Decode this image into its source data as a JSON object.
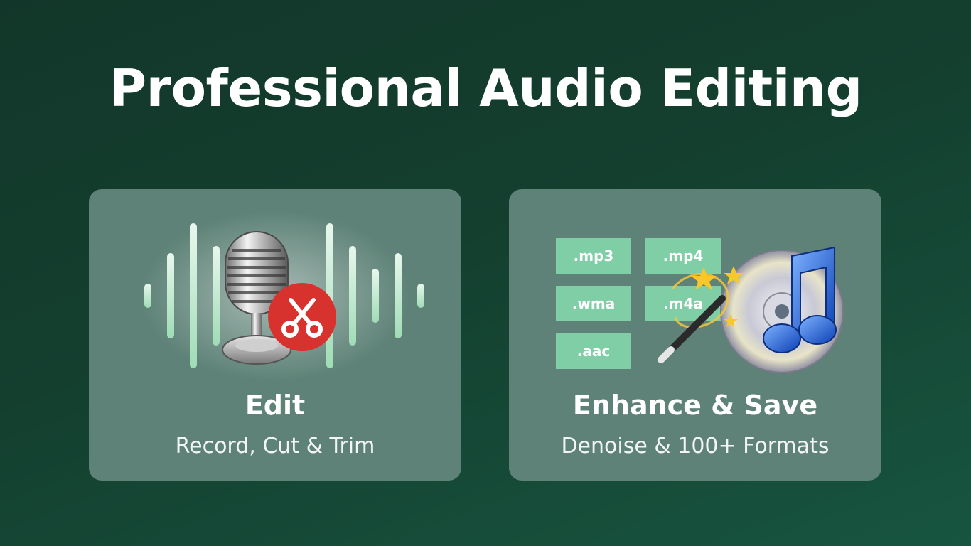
{
  "headline": "Professional Audio Editing",
  "cards": [
    {
      "title": "Edit",
      "subtitle": "Record, Cut & Trim",
      "icons": [
        "soundwave-icon",
        "microphone-icon",
        "scissors-icon"
      ]
    },
    {
      "title": "Enhance & Save",
      "subtitle": "Denoise & 100+ Formats",
      "formats": [
        ".mp3",
        ".mp4",
        ".wma",
        ".m4a",
        ".aac"
      ],
      "icons": [
        "magic-wand-icon",
        "music-cd-icon"
      ]
    }
  ],
  "colors": {
    "background": "#143f2f",
    "card": "#5e8277",
    "format_chip": "#7fcea6",
    "scissors_badge": "#d8322f",
    "wave_bar": "#a9e0bd"
  }
}
